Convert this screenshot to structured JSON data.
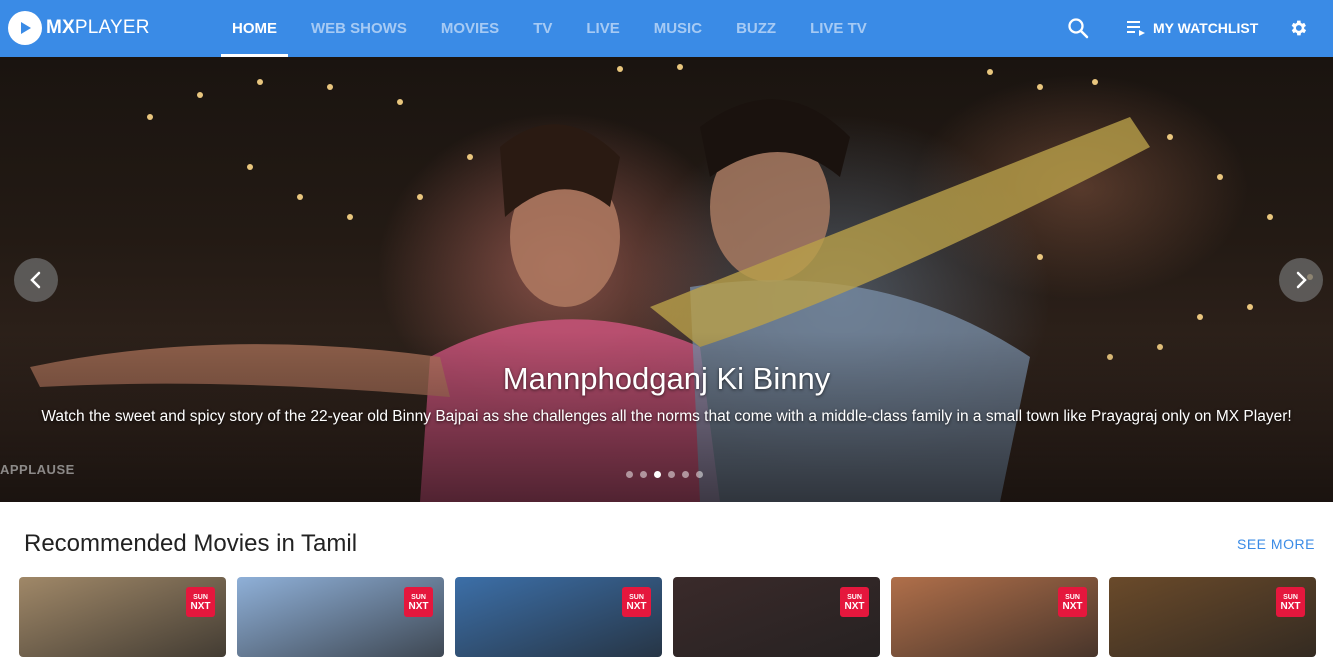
{
  "app": {
    "logo_bold": "MX",
    "logo_rest": "PLAYER",
    "accent_color": "#3a8be6"
  },
  "nav": {
    "items": [
      {
        "label": "HOME",
        "active": true
      },
      {
        "label": "WEB SHOWS",
        "active": false
      },
      {
        "label": "MOVIES",
        "active": false
      },
      {
        "label": "TV",
        "active": false
      },
      {
        "label": "LIVE",
        "active": false
      },
      {
        "label": "MUSIC",
        "active": false
      },
      {
        "label": "BUZZ",
        "active": false
      },
      {
        "label": "LIVE TV",
        "active": false
      }
    ],
    "search_icon": "search-icon",
    "watchlist_label": "MY WATCHLIST",
    "settings_icon": "gear-icon"
  },
  "hero": {
    "title": "Mannphodganj Ki Binny",
    "description": "Watch the sweet and spicy story of the 22-year old Binny Bajpai as she challenges all the norms that come with a middle-class family in a small town like Prayagraj only on MX Player!",
    "watermark": "APPLAUSE",
    "slide_count": 6,
    "active_slide": 3
  },
  "section": {
    "title": "Recommended Movies in Tamil",
    "see_more": "SEE MORE",
    "cards": [
      {
        "badge_top": "SUN",
        "badge_bottom": "NXT",
        "tint": "#a08868"
      },
      {
        "badge_top": "SUN",
        "badge_bottom": "NXT",
        "tint": "#8fb0d8"
      },
      {
        "badge_top": "SUN",
        "badge_bottom": "NXT",
        "tint": "#3c6fa8"
      },
      {
        "badge_top": "SUN",
        "badge_bottom": "NXT",
        "tint": "#3a2a2a"
      },
      {
        "badge_top": "SUN",
        "badge_bottom": "NXT",
        "tint": "#b06f4a"
      },
      {
        "badge_top": "SUN",
        "badge_bottom": "NXT",
        "tint": "#6a4a2a"
      }
    ]
  }
}
